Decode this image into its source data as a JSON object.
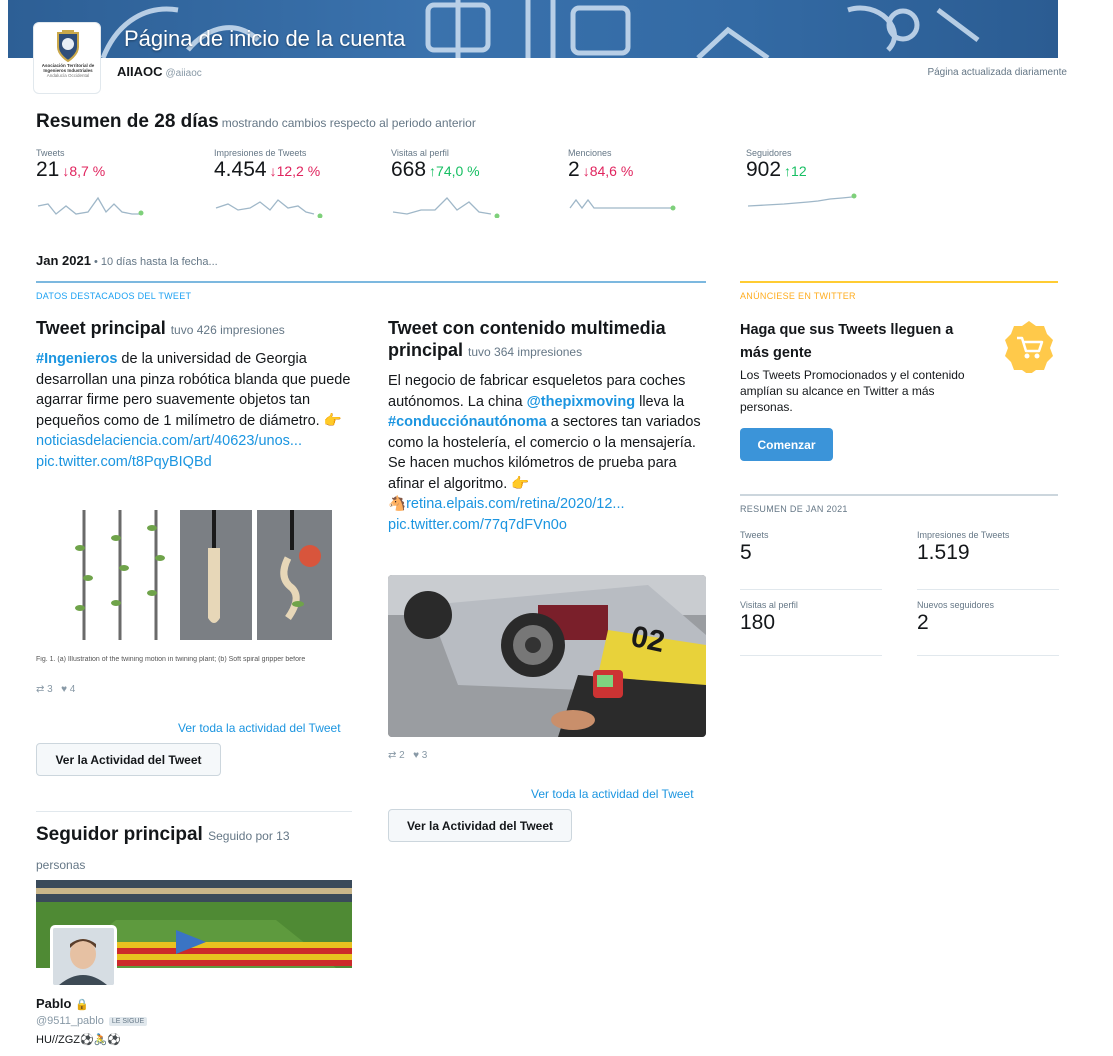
{
  "banner": {
    "title": "Página de inicio de la cuenta"
  },
  "logo": {
    "line1": "Asociación Territorial de",
    "line2": "Ingenieros Industriales",
    "line3": "Andalucía Occidental"
  },
  "account": {
    "name": "AIIAOC",
    "handle": "@aiiaoc",
    "updated": "Página actualizada diariamente"
  },
  "summary": {
    "title": "Resumen de 28 días",
    "note": "mostrando cambios respecto al periodo anterior",
    "stats": [
      {
        "label": "Tweets",
        "value": "21",
        "change": "↓8,7 %",
        "direction": "down"
      },
      {
        "label": "Impresiones de Tweets",
        "value": "4.454",
        "change": "↓12,2 %",
        "direction": "down"
      },
      {
        "label": "Visitas al perfil",
        "value": "668",
        "change": "↑74,0 %",
        "direction": "up"
      },
      {
        "label": "Menciones",
        "value": "2",
        "change": "↓84,6 %",
        "direction": "down"
      },
      {
        "label": "Seguidores",
        "value": "902",
        "change": "↑12",
        "direction": "up"
      }
    ]
  },
  "period": {
    "month": "Jan 2021",
    "rest": " • 10 días hasta la fecha..."
  },
  "highlights": {
    "header": "DATOS DESTACADOS DEL TWEET",
    "top_tweet": {
      "title": "Tweet principal",
      "impressions": "tuvo 426 impresiones",
      "hashtag": "#Ingenieros",
      "text": " de la universidad de Georgia desarrollan una pinza robótica blanda que puede agarrar firme pero suavemente objetos tan pequeños como de 1 milímetro de diámetro. ",
      "link_icon": "👉",
      "link": "noticiasdelaciencia.com/art/40623/unos...",
      "pic": "pic.twitter.com/t8PqyBIQBd",
      "caption": "Fig. 1. (a) Illustration of the twining motion in twining plant; (b) Soft spiral gripper before",
      "retweets": "3",
      "likes": "4",
      "view_all": "Ver toda la actividad del Tweet",
      "button": "Ver la Actividad del Tweet"
    },
    "top_media": {
      "title_line1": "Tweet con contenido multimedia",
      "title_line2": "principal",
      "impressions": "tuvo 364 impresiones",
      "text1": "El negocio de fabricar esqueletos para coches autónomos. La china ",
      "mention": "@thepixmoving",
      "text2": " lleva la ",
      "hashtag": "#conducciónautónoma",
      "text3": " a sectores tan variados como la hostelería, el comercio o la mensajería. Se hacen muchos kilómetros de prueba para afinar el algoritmo. 👉 ",
      "link_icon": "🐴",
      "link": "retina.elpais.com/retina/2020/12...",
      "pic": "pic.twitter.com/77q7dFVn0o",
      "plate": "02",
      "retweets": "2",
      "likes": "3",
      "view_all": "Ver toda la actividad del Tweet",
      "button": "Ver la Actividad del Tweet"
    }
  },
  "top_follower": {
    "title": "Seguidor principal",
    "note": "Seguido por 13 personas",
    "name": "Pablo",
    "lock": "🔒",
    "handle": "@9511_pablo",
    "badge": "LE SIGUE",
    "bio": "HU//ZGZ⚽🚴⚽"
  },
  "ad": {
    "header": "ANÚNCIESE EN TWITTER",
    "title": "Haga que sus Tweets lleguen a más gente",
    "text": "Los Tweets Promocionados y el contenido amplían su alcance en Twitter a más personas.",
    "button": "Comenzar"
  },
  "month_summary": {
    "header": "RESUMEN DE JAN 2021",
    "stats": [
      {
        "label": "Tweets",
        "value": "5"
      },
      {
        "label": "Impresiones de Tweets",
        "value": "1.519"
      },
      {
        "label": "Visitas al perfil",
        "value": "180"
      },
      {
        "label": "Nuevos seguidores",
        "value": "2"
      }
    ]
  },
  "colors": {
    "link": "#1b95e0",
    "down": "#e0245e",
    "up": "#17bf63",
    "ad_accent": "#ffad1f",
    "button": "#3b94d9"
  }
}
